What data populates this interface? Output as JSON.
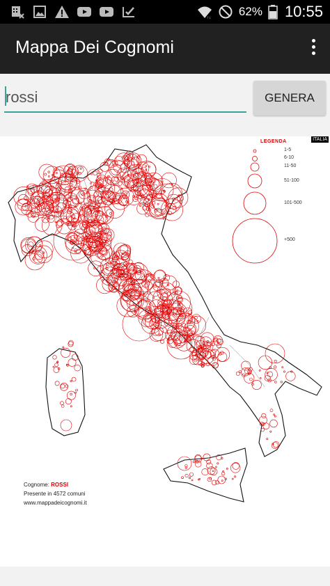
{
  "status_bar": {
    "left_icons": [
      "sim-card-blocked-icon",
      "image-icon",
      "warning-icon",
      "youtube-icon",
      "youtube-icon",
      "tasks-icon"
    ],
    "right_icons": [
      "wifi-icon",
      "do-not-disturb-icon",
      "battery-icon"
    ],
    "battery_percent": "62%",
    "time": "10:55"
  },
  "app_bar": {
    "title": "Mappa Dei Cognomi",
    "overflow_icon": "more-vert-icon"
  },
  "search": {
    "value": "rossi",
    "button_label": "GENERA",
    "accent_color": "#3aa298"
  },
  "map": {
    "corner_tag": "ITALIA",
    "legend": {
      "title": "LEGENDA",
      "items": [
        "1-5",
        "6-10",
        "11-50",
        "51-100",
        "101-500",
        "+500"
      ]
    },
    "info": {
      "surname_label": "Cognome:",
      "surname": "ROSSI",
      "presence": "Presente in 4572 comuni",
      "website": "www.mappadeicognomi.it"
    },
    "circle_color": "#e00000"
  }
}
